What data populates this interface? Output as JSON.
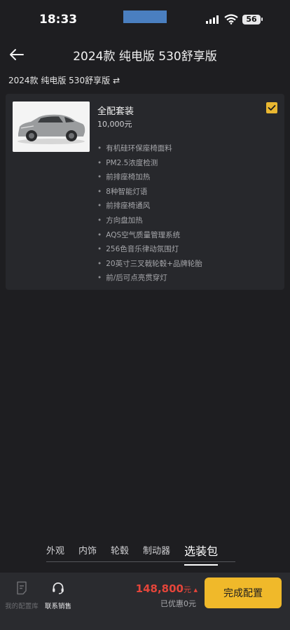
{
  "status": {
    "time": "18:33",
    "battery": "56"
  },
  "header": {
    "title": "2024款 纯电版 530舒享版"
  },
  "subline": {
    "text": "2024款 纯电版 530舒享版"
  },
  "package": {
    "name": "全配套装",
    "price": "10,000元",
    "selected": true,
    "features": [
      "有机硅环保座椅面料",
      "PM2.5浓度检测",
      "前排座椅加热",
      "8种智能灯语",
      "前排座椅通风",
      "方向盘加热",
      "AQS空气质量管理系统",
      "256色音乐律动氛围灯",
      "20英寸三叉戟轮毂+品牌轮胎",
      "前/后可点亮贯穿灯"
    ]
  },
  "tabs": [
    "外观",
    "内饰",
    "轮毂",
    "制动器",
    "选装包"
  ],
  "active_tab": "选装包",
  "footer": {
    "library_label": "我的配置库",
    "sales_label": "联系销售",
    "price": "148,800",
    "price_unit": "元",
    "discount": "已优惠0元",
    "done_label": "完成配置"
  },
  "colors": {
    "accent": "#f0b92a",
    "price": "#e5453a",
    "background": "#1e1e21"
  }
}
